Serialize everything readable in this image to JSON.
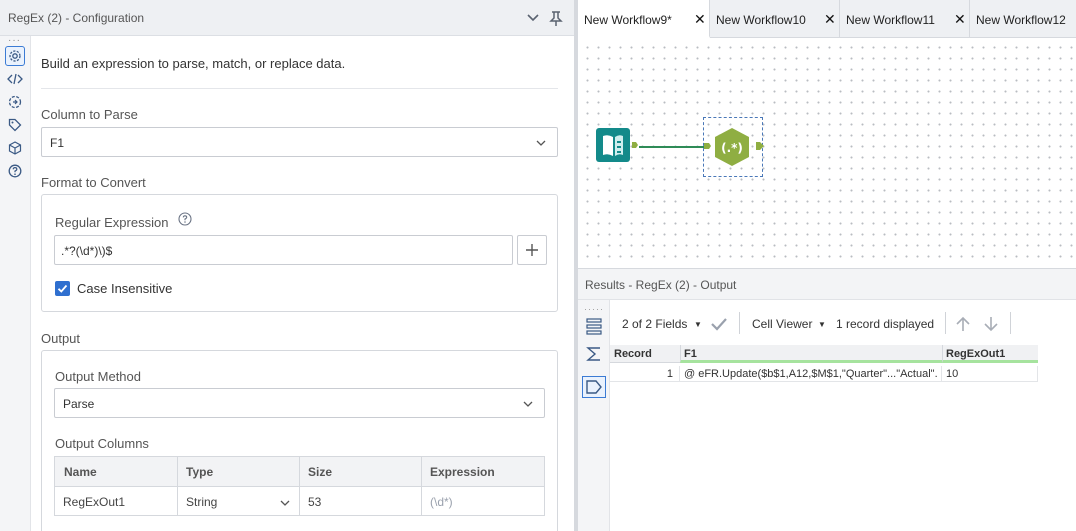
{
  "config": {
    "title": "RegEx (2) - Configuration",
    "description": "Build an expression to parse, match, or replace data.",
    "column_to_parse_label": "Column to Parse",
    "column_to_parse_value": "F1",
    "format_label": "Format to Convert",
    "regex_label": "Regular Expression",
    "regex_value": ".*?(\\d*)\\)$",
    "case_insensitive_label": "Case Insensitive",
    "case_insensitive_checked": true,
    "output_label": "Output",
    "output_method_label": "Output Method",
    "output_method_value": "Parse",
    "output_columns_label": "Output Columns",
    "columns_headers": [
      "Name",
      "Type",
      "Size",
      "Expression"
    ],
    "columns_row": {
      "name": "RegExOut1",
      "type": "String",
      "size": "53",
      "expression": "(\\d*)"
    }
  },
  "tabs": [
    {
      "label": "New Workflow9*",
      "active": true
    },
    {
      "label": "New Workflow10",
      "active": false
    },
    {
      "label": "New Workflow11",
      "active": false
    },
    {
      "label": "New Workflow12",
      "active": false
    }
  ],
  "results": {
    "title": "Results - RegEx (2) - Output",
    "fields_label": "2 of 2 Fields",
    "viewer_label": "Cell Viewer",
    "records_label": "1 record displayed",
    "headers": [
      "Record",
      "F1",
      "RegExOut1"
    ],
    "row": {
      "record": "1",
      "f1": "@ eFR.Update($b$1,A12,$M$1,\"Quarter\"...\"Actual\"...",
      "out": "10"
    }
  },
  "colors": {
    "accent": "#2f6fcf",
    "tool_green": "#8fae42",
    "tool_teal": "#138a8a"
  }
}
